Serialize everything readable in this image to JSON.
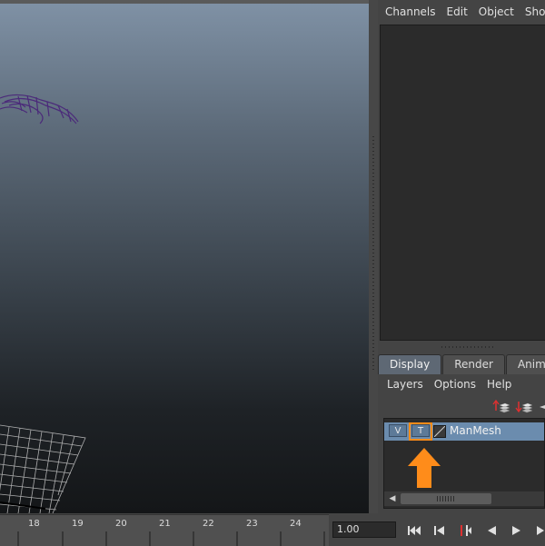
{
  "channel_box": {
    "menu": [
      "Channels",
      "Edit",
      "Object",
      "Show"
    ]
  },
  "layer_editor": {
    "tabs": [
      "Display",
      "Render",
      "Anim"
    ],
    "active_tab": "Display",
    "menu": [
      "Layers",
      "Options",
      "Help"
    ],
    "layers": [
      {
        "visible_label": "V",
        "template_label": "T",
        "name": "ManMesh"
      }
    ]
  },
  "timeline": {
    "frame_labels": [
      "18",
      "19",
      "20",
      "21",
      "22",
      "23",
      "24"
    ],
    "current_time": "1.00"
  },
  "colors": {
    "highlight": "#ff8c1a",
    "selected_layer": "#6b8cae"
  }
}
